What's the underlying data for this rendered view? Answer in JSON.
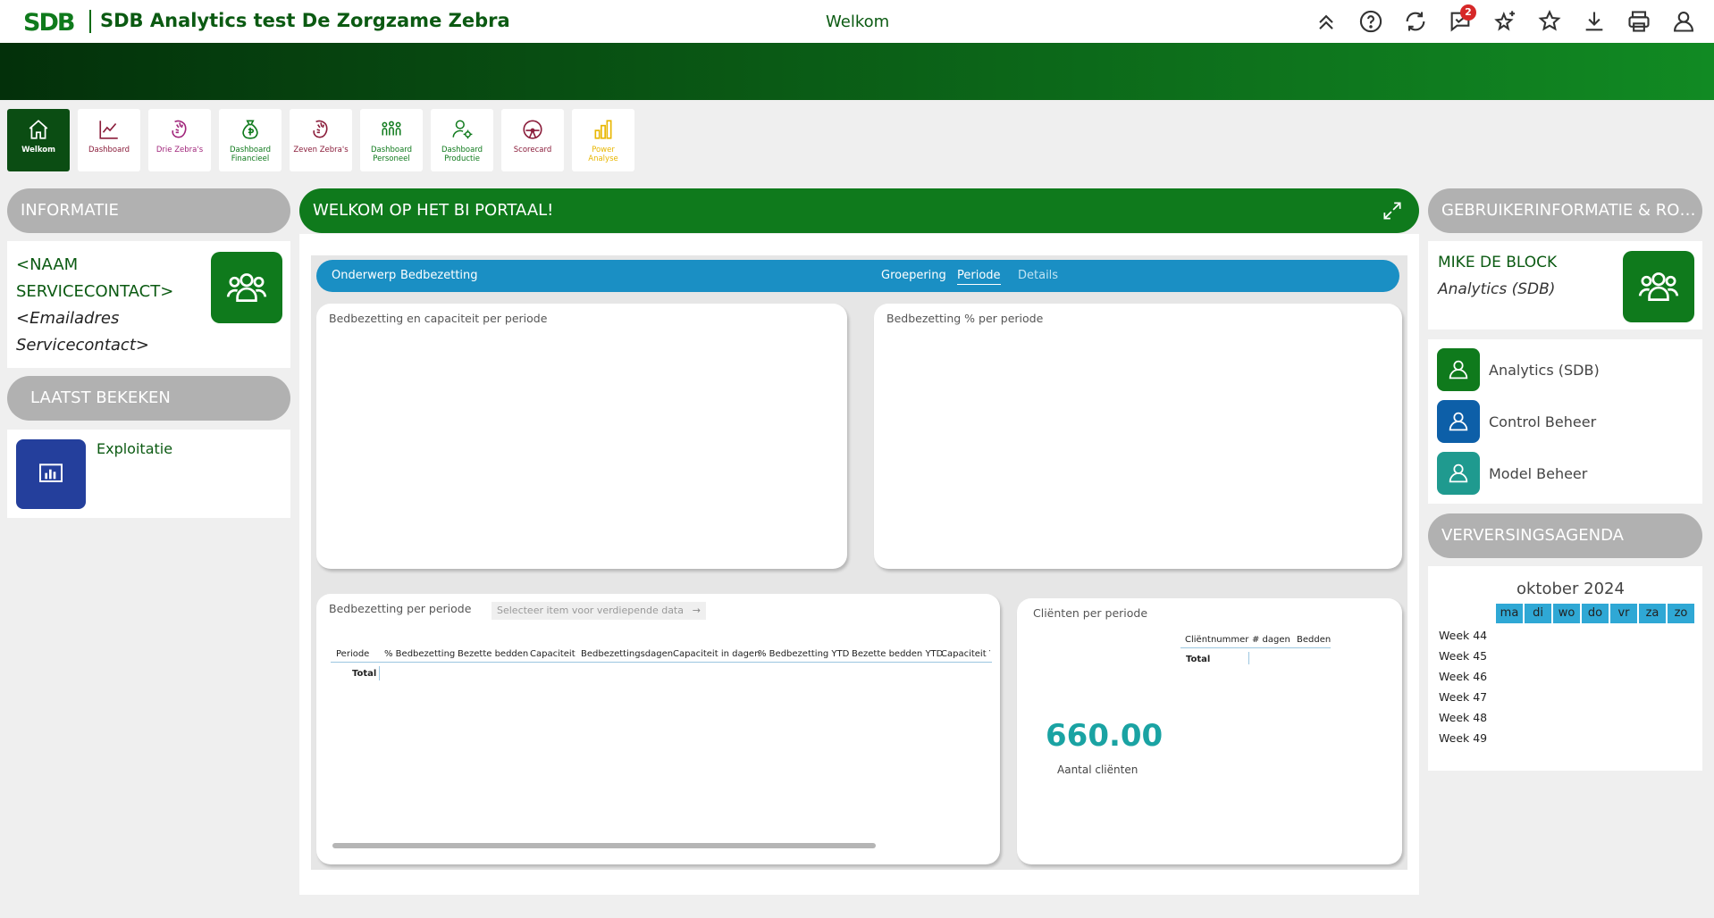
{
  "header": {
    "app_title": "SDB Analytics test De Zorgzame Zebra",
    "page_title": "Welkom",
    "notification_count": "2",
    "icons": [
      "collapse-up-icon",
      "help-icon",
      "refresh-icon",
      "comments-icon",
      "favorite-add-icon",
      "star-icon",
      "download-icon",
      "print-icon",
      "user-icon"
    ]
  },
  "nav": [
    {
      "label": "Welkom",
      "icon": "home-icon",
      "active": true
    },
    {
      "label": "Dashboard",
      "icon": "chart-line-icon"
    },
    {
      "label": "Drie Zebra's",
      "icon": "zebra-icon"
    },
    {
      "label": "Dashboard\nFinancieel",
      "icon": "money-bag-icon"
    },
    {
      "label": "Zeven Zebra's",
      "icon": "zebra-icon"
    },
    {
      "label": "Dashboard\nPersoneel",
      "icon": "people-icon"
    },
    {
      "label": "Dashboard\nProductie",
      "icon": "user-settings-icon"
    },
    {
      "label": "Scorecard",
      "icon": "gauge-icon"
    },
    {
      "label": "Power\nAnalyse",
      "icon": "bar-chart-icon"
    }
  ],
  "info": {
    "title": "INFORMATIE",
    "contact_name": "<NAAM SERVICECONTACT>",
    "contact_email": "<Emailadres Servicecontact>"
  },
  "recent": {
    "title": "LAATST BEKEKEN",
    "item": "Exploitatie"
  },
  "main": {
    "title": "WELKOM OP HET BI PORTAAL!",
    "report_nav": {
      "onderwerp": "Onderwerp",
      "bedbezetting": "Bedbezetting",
      "groepering": "Groepering",
      "periode": "Periode",
      "details": "Details"
    },
    "visual1_title": "Bedbezetting en capaciteit per periode",
    "visual2_title": "Bedbezetting % per periode",
    "visual3_title": "Bedbezetting per periode",
    "visual3_select": "Selecteer item voor verdiepende data",
    "table_headers": [
      "Periode",
      "% Bedbezetting",
      "Bezette bedden",
      "Capaciteit",
      "Bedbezettingsdagen",
      "Capaciteit in dagen",
      "% Bedbezetting YTD",
      "Bezette bedden YTD",
      "Capaciteit Y"
    ],
    "table_total": "Total",
    "visual4_title": "Cliënten per periode",
    "visual4_headers": [
      "Cliëntnummer",
      "# dagen",
      "Bedden"
    ],
    "visual4_total": "Total",
    "kpi_value": "660.00",
    "kpi_label": "Aantal cliënten"
  },
  "user": {
    "title": "GEBRUIKERINFORMATIE & ROL...",
    "name": "MIKE DE BLOCK",
    "role": "Analytics (SDB)",
    "roles": [
      {
        "label": "Analytics (SDB)",
        "color": "#0f7a1c"
      },
      {
        "label": "Control Beheer",
        "color": "#0d5fa8"
      },
      {
        "label": "Model Beheer",
        "color": "#1f9a8f"
      }
    ]
  },
  "agenda": {
    "title": "VERVERSINGSAGENDA",
    "month": "oktober 2024",
    "days": [
      "ma",
      "di",
      "wo",
      "do",
      "vr",
      "za",
      "zo"
    ],
    "weeks": [
      "Week 44",
      "Week 45",
      "Week 46",
      "Week 47",
      "Week 48",
      "Week 49"
    ]
  }
}
